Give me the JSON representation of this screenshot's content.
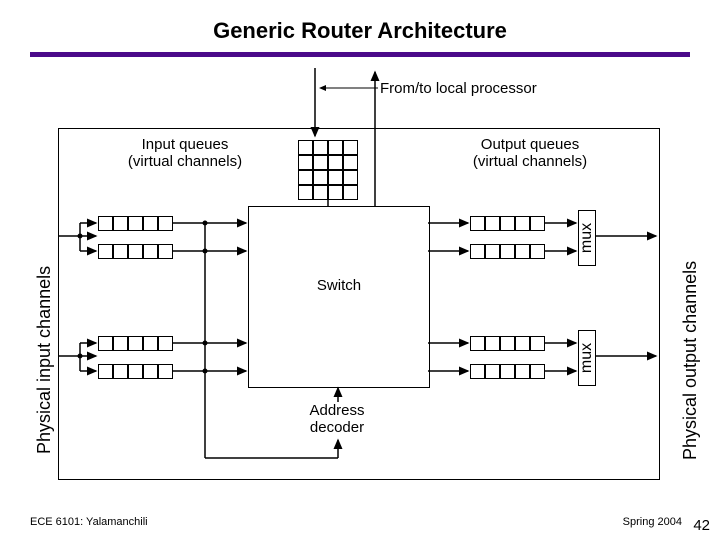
{
  "title": "Generic Router Architecture",
  "labels": {
    "local_proc": "From/to local processor",
    "input_q1": "Input queues",
    "input_q2": "(virtual channels)",
    "output_q1": "Output queues",
    "output_q2": "(virtual channels)",
    "phys_in": "Physical input channels",
    "phys_out": "Physical output channels",
    "switch": "Switch",
    "addr_dec1": "Address",
    "addr_dec2": "decoder",
    "mux": "mux"
  },
  "footer": {
    "left": "ECE 6101: Yalamanchili",
    "right": "Spring 2004",
    "page": "42"
  },
  "chart_data": {
    "type": "diagram",
    "title": "Generic Router Architecture",
    "components": [
      "Physical input channels",
      "Input queues (virtual channels)",
      "Switch",
      "Address decoder",
      "Output queues (virtual channels)",
      "mux",
      "Physical output channels",
      "From/to local processor"
    ]
  }
}
